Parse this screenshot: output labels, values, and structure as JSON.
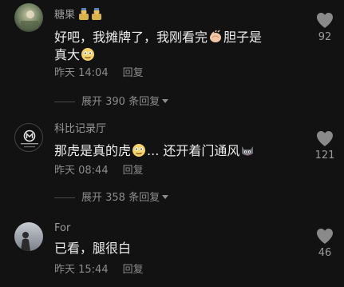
{
  "comments": [
    {
      "username": "糖果",
      "text_part1": "好吧，我摊牌了，我刚看完",
      "text_part2": "胆子是",
      "text_line2": "真大",
      "time": "昨天 14:04",
      "reply": "回复",
      "likes": "92",
      "expand": "展开 390 条回复"
    },
    {
      "username": "科比记录厅",
      "avatar_text": "M",
      "text_part1": "那虎是真的虎",
      "text_part2": "... 还开着门通风",
      "time": "昨天 08:44",
      "reply": "回复",
      "likes": "121",
      "expand": "展开 358 条回复"
    },
    {
      "username": "For",
      "text_part1": "已看，腿很白",
      "time": "昨天 15:44",
      "reply": "回复",
      "likes": "46"
    }
  ],
  "colors": {
    "background": "#121212",
    "text": "#ededed",
    "muted": "#8c8c8c",
    "heart": "#8a8a8a"
  },
  "icons": {
    "like": "heart-icon",
    "expand": "caret-down-icon",
    "emoji_clap": "clapping-hands-emoji",
    "emoji_smirk": "sly-face-emoji",
    "emoji_cat": "cat-face-emoji",
    "badge": "person-badge-icon"
  }
}
